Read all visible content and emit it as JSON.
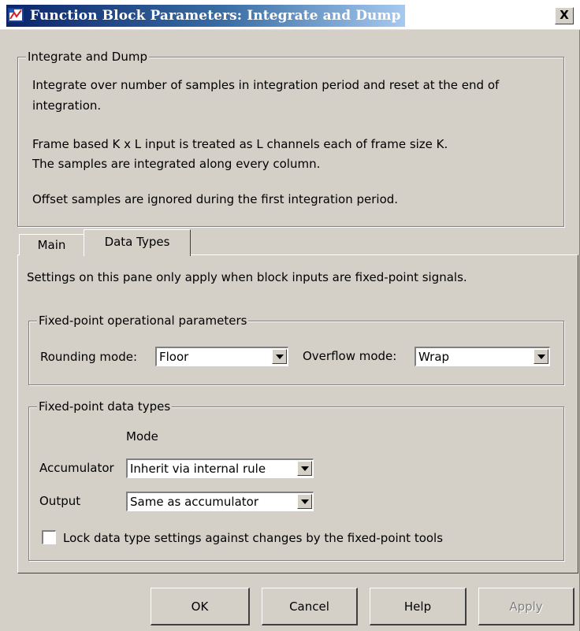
{
  "window": {
    "title": "Function Block Parameters: Integrate and Dump",
    "close_label": "X"
  },
  "description": {
    "group_title": "Integrate and Dump",
    "lines": [
      "Integrate over number of samples in integration period and reset at the end of",
      "integration.",
      "Frame based K x L input is treated as L channels each of frame size K.",
      "The samples are integrated along every column.",
      "Offset samples are ignored during the first integration period."
    ]
  },
  "tabs": [
    {
      "label": "Main",
      "selected": false
    },
    {
      "label": "Data Types",
      "selected": true
    }
  ],
  "data_types": {
    "intro": "Settings on this pane only apply when block inputs are fixed-point signals.",
    "operational": {
      "group_title": "Fixed-point operational parameters",
      "rounding_label": "Rounding mode:",
      "rounding_value": "Floor",
      "overflow_label": "Overflow mode:",
      "overflow_value": "Wrap"
    },
    "types": {
      "group_title": "Fixed-point data types",
      "mode_header": "Mode",
      "accumulator_label": "Accumulator",
      "accumulator_value": "Inherit via internal rule",
      "output_label": "Output",
      "output_value": "Same as accumulator"
    },
    "lock": {
      "label": "Lock data type settings against changes by the fixed-point tools",
      "checked": false
    }
  },
  "buttons": {
    "ok": "OK",
    "cancel": "Cancel",
    "help": "Help",
    "apply": "Apply"
  },
  "colors": {
    "face": "#d4d0c8",
    "title_active": "#0a246a"
  }
}
